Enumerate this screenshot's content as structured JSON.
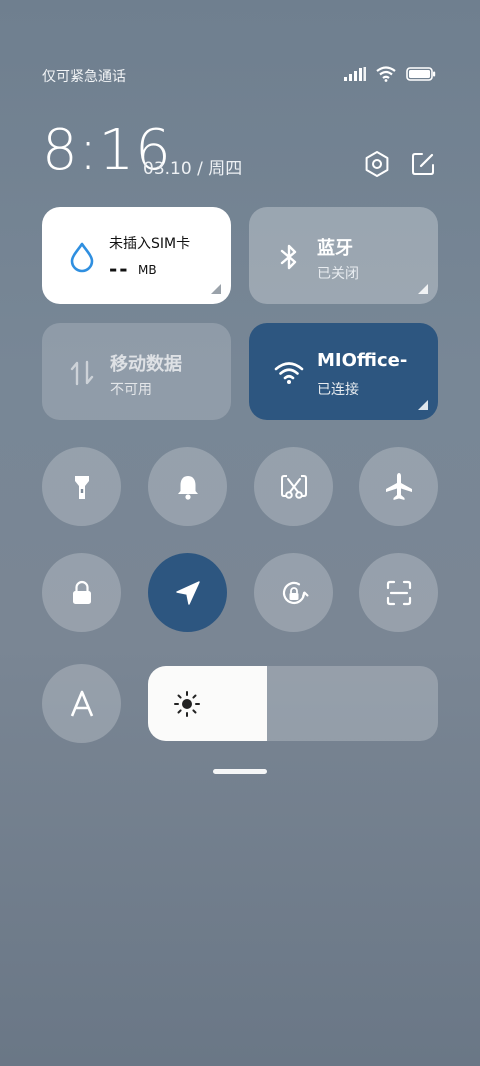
{
  "status_bar": {
    "carrier_text": "仅可紧急通话"
  },
  "header": {
    "time": "8:16",
    "date": "03.10 / 周四"
  },
  "tiles": {
    "sim": {
      "title": "未插入SIM卡",
      "data_value": "--",
      "data_unit": "MB"
    },
    "bluetooth": {
      "title": "蓝牙",
      "status": "已关闭"
    },
    "mobile_data": {
      "title": "移动数据",
      "status": "不可用"
    },
    "wifi": {
      "title": "MIOffice-",
      "status": "已连接"
    }
  },
  "brightness": {
    "level_fraction": 0.41
  },
  "colors": {
    "accent": "#2d5680",
    "sim_icon": "#2f8fe0"
  }
}
